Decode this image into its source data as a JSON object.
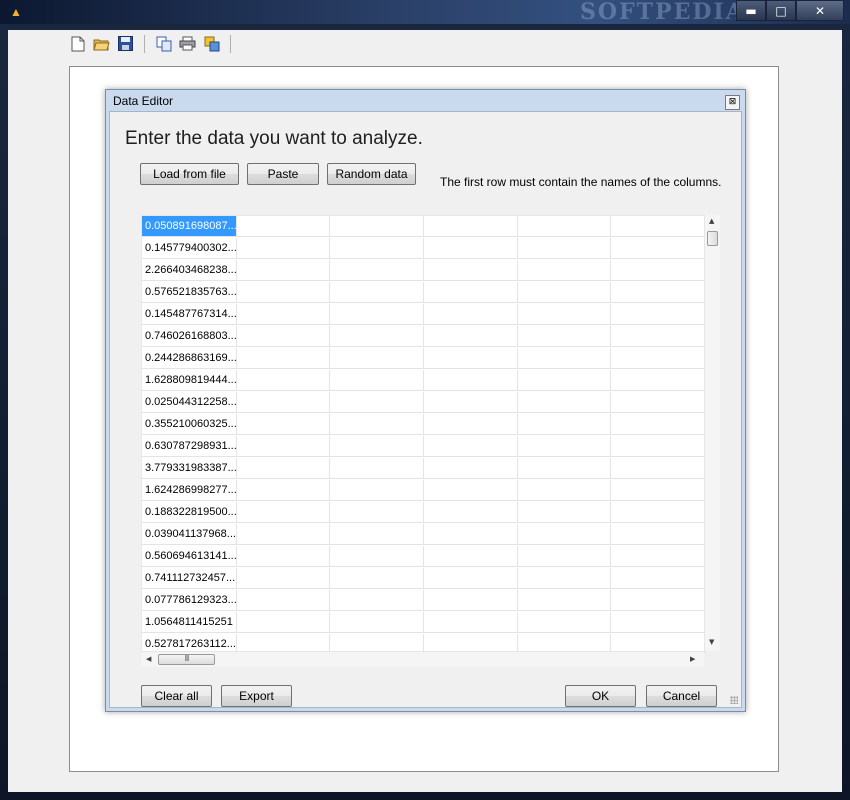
{
  "window": {
    "watermark": "SOFTPEDIA",
    "controls": {
      "minimize": "▬",
      "maximize": "□",
      "close": "✕"
    }
  },
  "toolbar": {
    "icons": [
      "new-file-icon",
      "open-folder-icon",
      "save-icon",
      "copy-icon",
      "print-icon",
      "export-image-icon"
    ]
  },
  "dialog": {
    "title": "Data Editor",
    "close_glyph": "⊠",
    "heading": "Enter the data you want to analyze.",
    "buttons": {
      "load": "Load from file",
      "paste": "Paste",
      "random": "Random data",
      "clear": "Clear all",
      "export": "Export",
      "ok": "OK",
      "cancel": "Cancel"
    },
    "hint": "The first row must contain the names of the columns.",
    "grid": {
      "rows": [
        [
          "0.050891698087...",
          "",
          "",
          "",
          "",
          ""
        ],
        [
          "0.145779400302...",
          "",
          "",
          "",
          "",
          ""
        ],
        [
          "2.266403468238...",
          "",
          "",
          "",
          "",
          ""
        ],
        [
          "0.576521835763...",
          "",
          "",
          "",
          "",
          ""
        ],
        [
          "0.145487767314...",
          "",
          "",
          "",
          "",
          ""
        ],
        [
          "0.746026168803...",
          "",
          "",
          "",
          "",
          ""
        ],
        [
          "0.244286863169...",
          "",
          "",
          "",
          "",
          ""
        ],
        [
          "1.628809819444...",
          "",
          "",
          "",
          "",
          ""
        ],
        [
          "0.025044312258...",
          "",
          "",
          "",
          "",
          ""
        ],
        [
          "0.355210060325...",
          "",
          "",
          "",
          "",
          ""
        ],
        [
          "0.630787298931...",
          "",
          "",
          "",
          "",
          ""
        ],
        [
          "3.779331983387...",
          "",
          "",
          "",
          "",
          ""
        ],
        [
          "1.624286998277...",
          "",
          "",
          "",
          "",
          ""
        ],
        [
          "0.188322819500...",
          "",
          "",
          "",
          "",
          ""
        ],
        [
          "0.039041137968...",
          "",
          "",
          "",
          "",
          ""
        ],
        [
          "0.560694613141...",
          "",
          "",
          "",
          "",
          ""
        ],
        [
          "0.741112732457...",
          "",
          "",
          "",
          "",
          ""
        ],
        [
          "0.077786129323...",
          "",
          "",
          "",
          "",
          ""
        ],
        [
          "1.0564811415251",
          "",
          "",
          "",
          "",
          ""
        ],
        [
          "0.527817263112...",
          "",
          "",
          "",
          "",
          ""
        ]
      ]
    },
    "scrollbar": {
      "up": "▲",
      "down": "▼",
      "left": "◀",
      "right": "▶",
      "thumb_grip": "III"
    }
  }
}
